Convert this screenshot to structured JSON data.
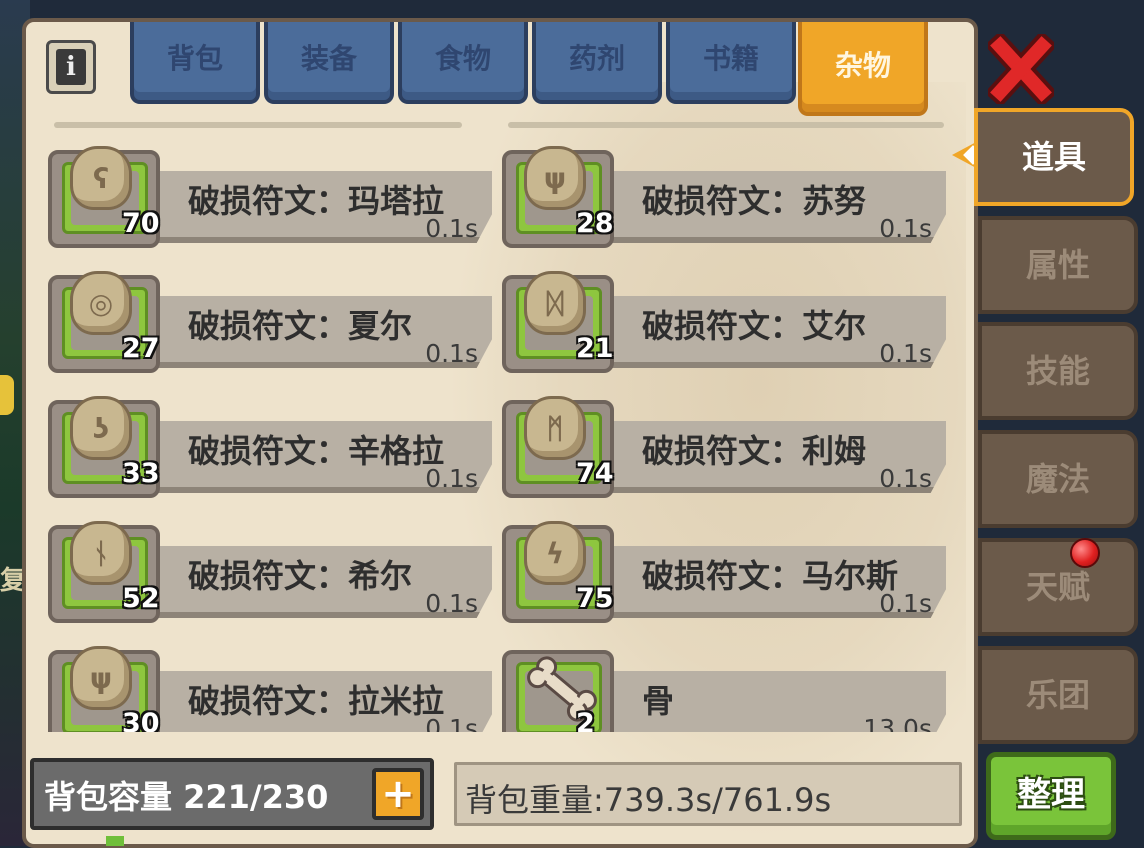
{
  "left_edge_text": "复",
  "category_tabs": [
    {
      "label": "背包",
      "active": false
    },
    {
      "label": "装备",
      "active": false
    },
    {
      "label": "食物",
      "active": false
    },
    {
      "label": "药剂",
      "active": false
    },
    {
      "label": "书籍",
      "active": false
    },
    {
      "label": "杂物",
      "active": true
    }
  ],
  "info_button_glyph": "i",
  "items": [
    {
      "name": "破损符文：玛塔拉",
      "weight": "0.1s",
      "count": "70",
      "icon": "rune-icon"
    },
    {
      "name": "破损符文：苏努",
      "weight": "0.1s",
      "count": "28",
      "icon": "rune-icon"
    },
    {
      "name": "破损符文：夏尔",
      "weight": "0.1s",
      "count": "27",
      "icon": "rune-icon"
    },
    {
      "name": "破损符文：艾尔",
      "weight": "0.1s",
      "count": "21",
      "icon": "rune-icon"
    },
    {
      "name": "破损符文：辛格拉",
      "weight": "0.1s",
      "count": "33",
      "icon": "rune-icon"
    },
    {
      "name": "破损符文：利姆",
      "weight": "0.1s",
      "count": "74",
      "icon": "rune-icon"
    },
    {
      "name": "破损符文：希尔",
      "weight": "0.1s",
      "count": "52",
      "icon": "rune-icon"
    },
    {
      "name": "破损符文：马尔斯",
      "weight": "0.1s",
      "count": "75",
      "icon": "rune-icon"
    },
    {
      "name": "破损符文：拉米拉",
      "weight": "0.1s",
      "count": "30",
      "icon": "rune-icon"
    },
    {
      "name": "骨",
      "weight": "13.0s",
      "count": "2",
      "icon": "bone-icon"
    }
  ],
  "capacity": {
    "label": "背包容量 221/230",
    "plus": "+"
  },
  "weight_total": "背包重量:739.3s/761.9s",
  "side_tabs": [
    {
      "label": "道具",
      "active": true
    },
    {
      "label": "属性",
      "active": false
    },
    {
      "label": "技能",
      "active": false
    },
    {
      "label": "魔法",
      "active": false
    },
    {
      "label": "天赋",
      "active": false,
      "notification": true
    },
    {
      "label": "乐团",
      "active": false
    }
  ],
  "tidy_button": "整理",
  "colors": {
    "panel": "#eee3cc",
    "tab_inactive": "#4b6c9a",
    "tab_active": "#f0a628",
    "slot_green": "#8ec63f",
    "close_red": "#e02828",
    "tidy_green": "#7ac43a"
  }
}
